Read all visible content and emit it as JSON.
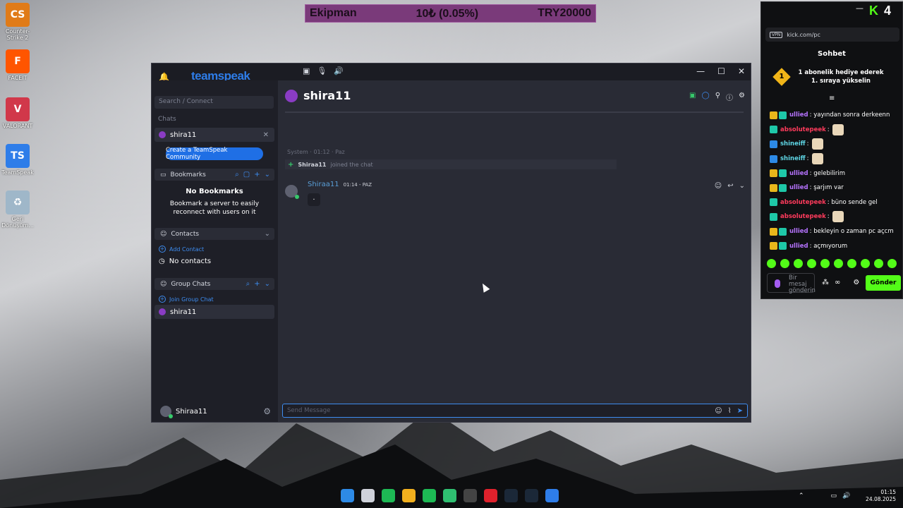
{
  "desktop_icons": [
    {
      "label": "Counter-Strike 2",
      "color": "#e07b18",
      "glyph": "CS"
    },
    {
      "label": "FACEIT",
      "color": "#ff5500",
      "glyph": "F"
    },
    {
      "label": "VALORANT",
      "color": "#d1384a",
      "glyph": "V"
    },
    {
      "label": "TeamSpeak",
      "color": "#2e7de9",
      "glyph": "TS"
    },
    {
      "label": "Geri Dönüşüm...",
      "color": "#9fb7c9",
      "glyph": "♻"
    }
  ],
  "ticker": {
    "left": "Ekipman",
    "middle": "10₺ (0.05%)",
    "right": "TRY20000"
  },
  "teamspeak": {
    "logo": "teamspeak",
    "window_controls": [
      "—",
      "☐",
      "✕"
    ],
    "search_placeholder": "Search / Connect",
    "chats_label": "Chats",
    "active_chat": "shira11",
    "create_community": "Create a TeamSpeak Community",
    "bookmarks": {
      "header": "Bookmarks",
      "empty_title": "No Bookmarks",
      "empty_desc": "Bookmark a server to easily reconnect with users on it"
    },
    "contacts": {
      "header": "Contacts",
      "add": "Add Contact",
      "empty": "No contacts"
    },
    "group_chats": {
      "header": "Group Chats",
      "join": "Join Group Chat",
      "item": "shira11"
    },
    "current_user": "Shiraa11",
    "chat": {
      "title": "shira11",
      "system_line": "System · 01:12 · Paz",
      "join_user": "Shiraa11",
      "join_text": "joined the chat",
      "message": {
        "author": "Shiraa11",
        "time": "01:14 - PAZ",
        "text": "."
      },
      "send_placeholder": "Send Message"
    }
  },
  "kick": {
    "brand": "K",
    "brand_num": "4",
    "url": "kick.com/pc",
    "panel_title": "Sohbet",
    "gift_badge": "1",
    "gift_text": "1 abonelik hediye ederek 1. sıraya yükselin",
    "messages": [
      {
        "user": "ullied",
        "color": "#b673ff",
        "badges": [
          "crown",
          "teal"
        ],
        "text": ": yayından sonra derkeenn",
        "emote": false
      },
      {
        "user": "absolutepeek",
        "color": "#ff3b5c",
        "badges": [
          "teal"
        ],
        "text": ":",
        "emote": true
      },
      {
        "user": "shineiff",
        "color": "#5fd7e6",
        "badges": [
          "blue"
        ],
        "text": ":",
        "emote": true
      },
      {
        "user": "shineiff",
        "color": "#5fd7e6",
        "badges": [
          "blue"
        ],
        "text": ":",
        "emote": true
      },
      {
        "user": "ullied",
        "color": "#b673ff",
        "badges": [
          "crown",
          "teal"
        ],
        "text": ": gelebilirim",
        "emote": false
      },
      {
        "user": "ullied",
        "color": "#b673ff",
        "badges": [
          "crown",
          "teal"
        ],
        "text": ": şarjım var",
        "emote": false
      },
      {
        "user": "absolutepeek",
        "color": "#ff3b5c",
        "badges": [
          "teal"
        ],
        "text": ": büno sende gel",
        "emote": false
      },
      {
        "user": "absolutepeek",
        "color": "#ff3b5c",
        "badges": [
          "teal"
        ],
        "text": ":",
        "emote": true
      },
      {
        "user": "ullied",
        "color": "#b673ff",
        "badges": [
          "crown",
          "teal"
        ],
        "text": ": bekleyin o zaman pc açcm",
        "emote": false
      },
      {
        "user": "ullied",
        "color": "#b673ff",
        "badges": [
          "crown",
          "teal"
        ],
        "text": ": açmıyorum",
        "emote": false
      }
    ],
    "input_placeholder": "Bir mesaj gönderin",
    "send_label": "Gönder"
  },
  "taskbar": {
    "apps": [
      "#2d8ae6",
      "#cfd2da",
      "#1db954",
      "#f2b01e",
      "#1db954",
      "#2fbf71",
      "#444444",
      "#e0212c",
      "#1b2838",
      "#1b2838",
      "#2e7de9"
    ],
    "time": "01:15",
    "date": "24.08.2025"
  }
}
